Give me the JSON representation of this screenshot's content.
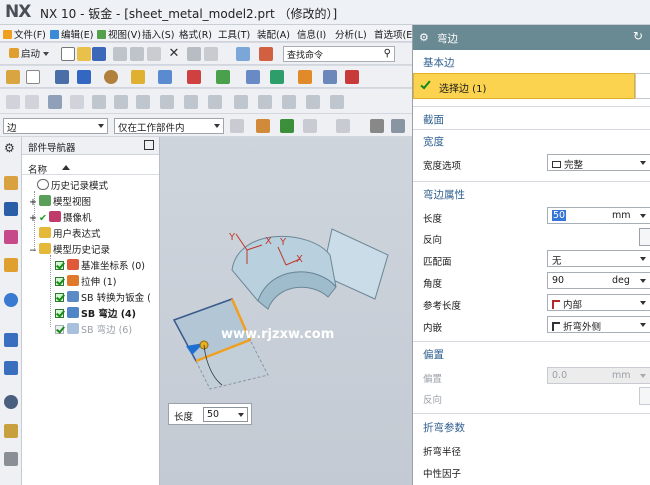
{
  "window": {
    "logo": "NX",
    "title": "NX 10 - 钣金 - [sheet_metal_model2.prt （修改的）]"
  },
  "menu": {
    "items": [
      {
        "label": "文件(F)"
      },
      {
        "label": "编辑(E)"
      },
      {
        "label": "视图(V)"
      },
      {
        "label": "插入(S)"
      },
      {
        "label": "格式(R)"
      },
      {
        "label": "工具(T)"
      },
      {
        "label": "装配(A)"
      },
      {
        "label": "信息(I)"
      },
      {
        "label": "分析(L)"
      },
      {
        "label": "首选项(E"
      }
    ]
  },
  "toolbar": {
    "start_label": "启动",
    "search_placeholder": "查找命令"
  },
  "selection_bar": {
    "filter_value": "边",
    "scope_value": "仅在工作部件内"
  },
  "navigator": {
    "title": "部件导航器",
    "column_name": "名称",
    "items": [
      {
        "label": "历史记录模式"
      },
      {
        "label": "模型视图"
      },
      {
        "label": "摄像机"
      },
      {
        "label": "用户表达式"
      },
      {
        "label": "模型历史记录"
      },
      {
        "label": "基准坐标系 (0)"
      },
      {
        "label": "拉伸 (1)"
      },
      {
        "label": "SB 转换为钣金 ("
      },
      {
        "label": "SB 弯边 (4)"
      },
      {
        "label": "SB 弯边 (6)"
      }
    ]
  },
  "viewport": {
    "length_label": "长度",
    "length_value": "50",
    "watermark": "www.rjzxw.com"
  },
  "dialog": {
    "title": "弯边",
    "sections": {
      "base_edge": "基本边",
      "select_edge": "选择边 (1)",
      "profile": "截面",
      "width": "宽度",
      "width_option_label": "宽度选项",
      "width_option_value": "完整",
      "flange_props": "弯边属性",
      "length_label": "长度",
      "length_value": "50",
      "length_unit": "mm",
      "reverse_label": "反向",
      "match_face_label": "匹配面",
      "match_face_value": "无",
      "angle_label": "角度",
      "angle_value": "90",
      "angle_unit": "deg",
      "ref_length_label": "参考长度",
      "ref_length_value": "内部",
      "inset_label": "内嵌",
      "inset_value": "折弯外侧",
      "offset": "偏置",
      "offset_label": "偏置",
      "offset_value": "0.0",
      "offset_unit": "mm",
      "offset_reverse_label": "反向",
      "bend_params": "折弯参数",
      "bend_radius_label": "折弯半径",
      "neutral_factor_label": "中性因子"
    }
  },
  "colors": {
    "dialog_header": "#6a8a93",
    "section_text": "#2f5f8f",
    "selection_highlight": "#fbd34f"
  }
}
